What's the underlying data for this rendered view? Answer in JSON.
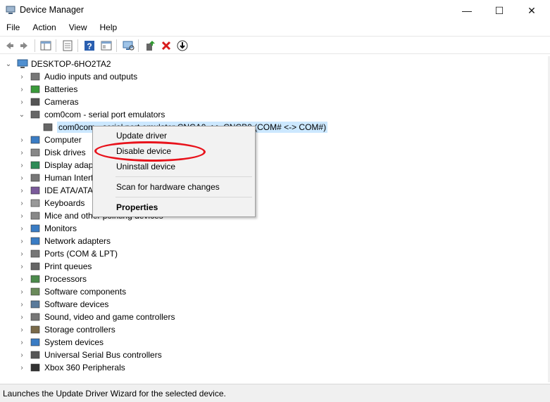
{
  "window": {
    "title": "Device Manager",
    "controls": {
      "minimize": "—",
      "maximize": "☐",
      "close": "✕"
    }
  },
  "menu": [
    "File",
    "Action",
    "View",
    "Help"
  ],
  "toolbar": [
    {
      "name": "back-icon"
    },
    {
      "name": "forward-icon"
    },
    {
      "name": "show-hide-console-tree-icon"
    },
    {
      "name": "properties-icon"
    },
    {
      "name": "help-icon"
    },
    {
      "name": "view-icon"
    },
    {
      "name": "scan-hardware-icon"
    },
    {
      "name": "update-driver-icon"
    },
    {
      "name": "uninstall-icon"
    },
    {
      "name": "enable-device-icon"
    }
  ],
  "tree": {
    "root": "DESKTOP-6HO2TA2",
    "items": [
      {
        "label": "Audio inputs and outputs",
        "icon": "audio-icon"
      },
      {
        "label": "Batteries",
        "icon": "battery-icon"
      },
      {
        "label": "Cameras",
        "icon": "camera-icon"
      },
      {
        "label": "com0com - serial port emulators",
        "icon": "port-connector-icon",
        "expanded": true
      },
      {
        "label": "com0com - serial port emulator CNCA0 <-> CNCB0 (COM# <-> COM#)",
        "icon": "port-connector-icon",
        "child": true,
        "selected": true
      },
      {
        "label": "Computer",
        "icon": "computer-icon"
      },
      {
        "label": "Disk drives",
        "icon": "disk-drive-icon"
      },
      {
        "label": "Display adapters",
        "icon": "display-adapter-icon"
      },
      {
        "label": "Human Interface Devices",
        "icon": "hid-icon"
      },
      {
        "label": "IDE ATA/ATAPI controllers",
        "icon": "ide-icon"
      },
      {
        "label": "Keyboards",
        "icon": "keyboard-icon"
      },
      {
        "label": "Mice and other pointing devices",
        "icon": "mouse-icon"
      },
      {
        "label": "Monitors",
        "icon": "monitor-icon"
      },
      {
        "label": "Network adapters",
        "icon": "network-adapter-icon"
      },
      {
        "label": "Ports (COM & LPT)",
        "icon": "ports-icon"
      },
      {
        "label": "Print queues",
        "icon": "printer-icon"
      },
      {
        "label": "Processors",
        "icon": "processor-icon"
      },
      {
        "label": "Software components",
        "icon": "software-component-icon"
      },
      {
        "label": "Software devices",
        "icon": "software-device-icon"
      },
      {
        "label": "Sound, video and game controllers",
        "icon": "sound-icon"
      },
      {
        "label": "Storage controllers",
        "icon": "storage-controller-icon"
      },
      {
        "label": "System devices",
        "icon": "system-device-icon"
      },
      {
        "label": "Universal Serial Bus controllers",
        "icon": "usb-icon"
      },
      {
        "label": "Xbox 360 Peripherals",
        "icon": "gamepad-icon"
      }
    ]
  },
  "context_menu": {
    "update_driver": "Update driver",
    "disable_device": "Disable device",
    "uninstall_device": "Uninstall device",
    "scan": "Scan for hardware changes",
    "properties": "Properties"
  },
  "status": "Launches the Update Driver Wizard for the selected device.",
  "colors": {
    "selection": "#cce8ff",
    "annotation": "#e8121b",
    "menu_bg": "#f2f2f2"
  }
}
